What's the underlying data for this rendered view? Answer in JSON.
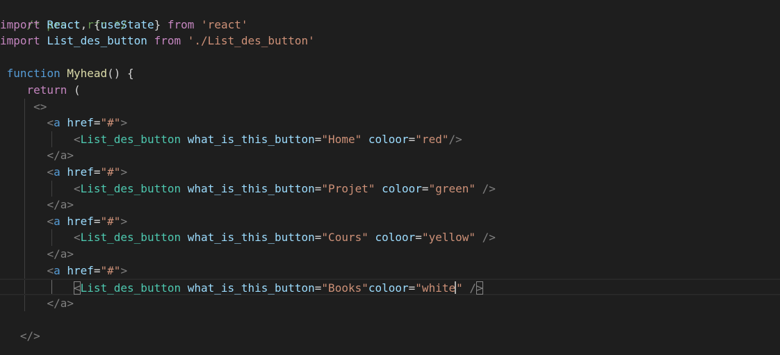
{
  "code": {
    "line1": "/* prs : rfc */",
    "line2": {
      "kw_import": "import",
      "ident": "React",
      "comma": ",",
      "brace_open": "{",
      "use_state": "useState",
      "brace_close": "}",
      "kw_from": "from",
      "module": "'react'"
    },
    "line3": {
      "kw_import": "import",
      "ident": "List_des_button",
      "kw_from": "from",
      "module": "'./List_des_button'"
    },
    "line5": {
      "kw_function": "function",
      "name": "Myhead",
      "parens": "()",
      "brace": "{"
    },
    "line6": {
      "kw_return": "return",
      "paren": "("
    },
    "line7": {
      "fragment_open": "<>"
    },
    "anchor": {
      "open_lt": "<",
      "tag": "a",
      "attr": "href",
      "eq": "=",
      "value": "\"#\"",
      "gt": ">",
      "close": "</a>"
    },
    "component_name": "List_des_button",
    "prop1": "what_is_this_button",
    "prop2": "coloor",
    "buttons": [
      {
        "label": "\"Home\"",
        "color": "\"red\"",
        "tail": "/>"
      },
      {
        "label": "\"Projet\"",
        "color": "\"green\"",
        "tail": " />"
      },
      {
        "label": "\"Cours\"",
        "color": "\"yellow\"",
        "tail": " />"
      },
      {
        "label": "\"Books\"",
        "color_a": "\"white",
        "color_b": "\"",
        "tail": " />"
      }
    ],
    "fragment_close": "</>"
  },
  "colors": {
    "background": "#1e1e1e",
    "comment": "#6a9955",
    "control_keyword": "#c586c0",
    "keyword": "#569cd6",
    "function": "#dcdcaa",
    "variable": "#9cdcfe",
    "string": "#ce9178",
    "component": "#4ec9b0",
    "bracket": "#808080"
  }
}
